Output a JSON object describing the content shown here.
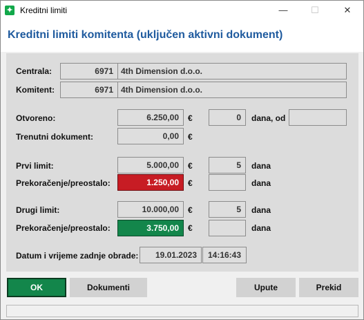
{
  "window": {
    "title": "Kreditni limiti",
    "app_icon_glyph": "✦"
  },
  "heading": "Kreditni limiti komitenta (uključen aktivni dokument)",
  "centrala": {
    "label": "Centrala:",
    "code": "6971",
    "name": "4th Dimension d.o.o."
  },
  "komitent": {
    "label": "Komitent:",
    "code": "6971",
    "name": "4th Dimension d.o.o."
  },
  "otvoreno": {
    "label": "Otvoreno:",
    "amount": "6.250,00",
    "currency": "€",
    "days": "0",
    "days_label": "dana, od",
    "from": ""
  },
  "trenutni": {
    "label": "Trenutni dokument:",
    "amount": "0,00",
    "currency": "€"
  },
  "prvi": {
    "label": "Prvi limit:",
    "amount": "5.000,00",
    "currency": "€",
    "days": "5",
    "days_label": "dana"
  },
  "prvi_prek": {
    "label": "Prekoračenje/preostalo:",
    "amount": "1.250,00",
    "currency": "€",
    "days": "",
    "days_label": "dana"
  },
  "drugi": {
    "label": "Drugi limit:",
    "amount": "10.000,00",
    "currency": "€",
    "days": "5",
    "days_label": "dana"
  },
  "drugi_prek": {
    "label": "Prekoračenje/preostalo:",
    "amount": "3.750,00",
    "currency": "€",
    "days": "",
    "days_label": "dana"
  },
  "obrada": {
    "label": "Datum i vrijeme zadnje obrade:",
    "date": "19.01.2023",
    "time": "14:16:43"
  },
  "buttons": {
    "ok": "OK",
    "dokumenti": "Dokumenti",
    "upute": "Upute",
    "prekid": "Prekid"
  },
  "titlebar_buttons": {
    "minimize": "—",
    "maximize": "☐",
    "close": "✕"
  },
  "colors": {
    "over_limit": "#c71c24",
    "remaining": "#13864b",
    "heading": "#1e5a9e"
  }
}
